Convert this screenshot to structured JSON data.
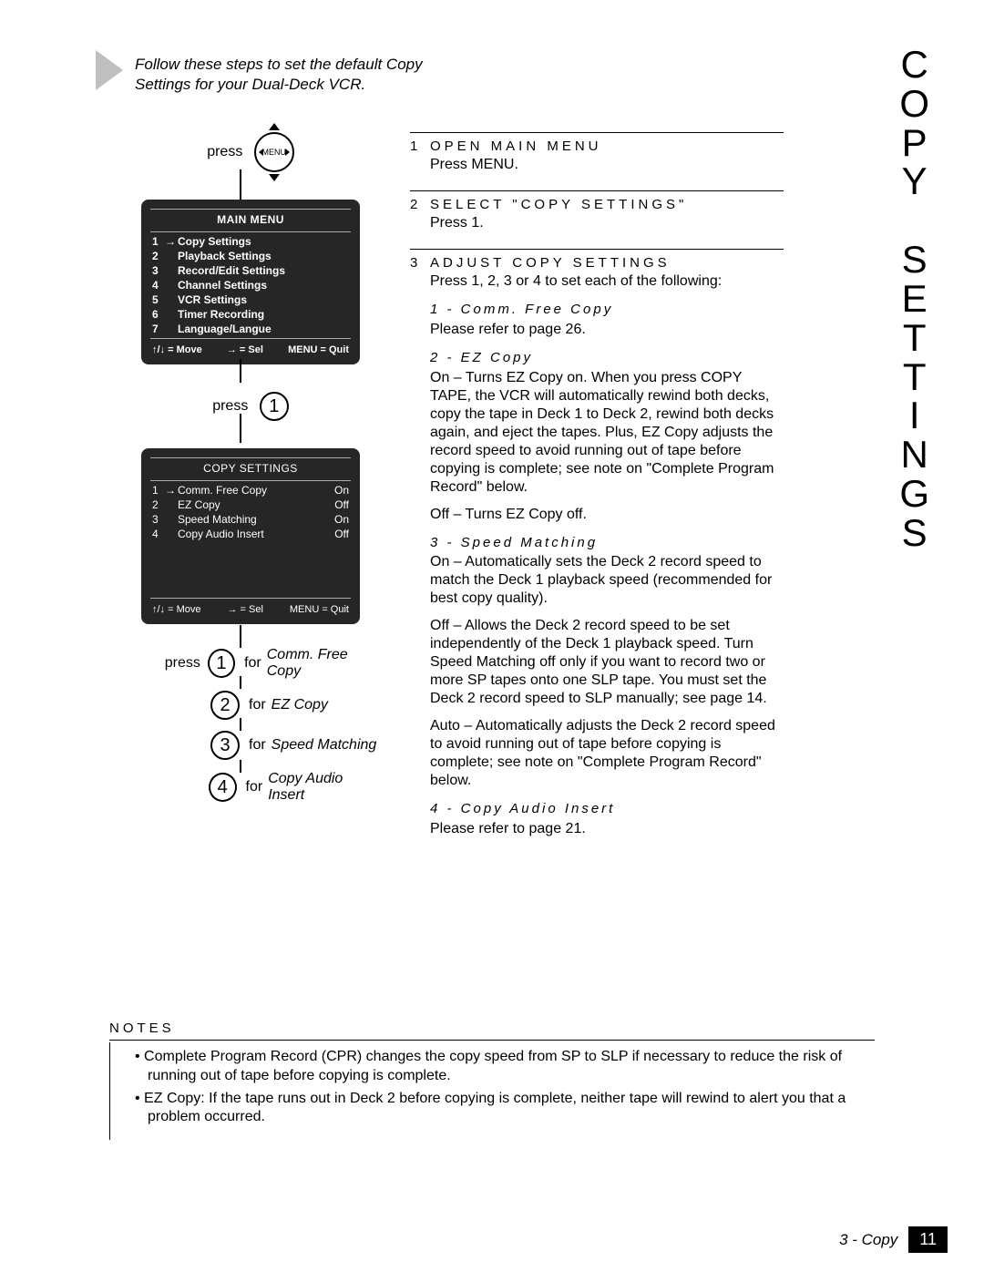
{
  "side_title": "COPY SETTINGS",
  "intro": "Follow these steps to set the default Copy Settings for your Dual-Deck VCR.",
  "press": "press",
  "for": "for",
  "menu_button": "MENU",
  "main_menu": {
    "title": "MAIN MENU",
    "items": [
      {
        "n": "1",
        "arrow": "→",
        "label": "Copy Settings"
      },
      {
        "n": "2",
        "arrow": "",
        "label": "Playback Settings"
      },
      {
        "n": "3",
        "arrow": "",
        "label": "Record/Edit Settings"
      },
      {
        "n": "4",
        "arrow": "",
        "label": "Channel Settings"
      },
      {
        "n": "5",
        "arrow": "",
        "label": "VCR Settings"
      },
      {
        "n": "6",
        "arrow": "",
        "label": "Timer Recording"
      },
      {
        "n": "7",
        "arrow": "",
        "label": "Language/Langue"
      }
    ],
    "footer": {
      "move": "↑/↓ = Move",
      "sel": "→ = Sel",
      "quit": "MENU = Quit"
    }
  },
  "press_1": "1",
  "copy_menu": {
    "title": "COPY SETTINGS",
    "items": [
      {
        "n": "1",
        "arrow": "→",
        "label": "Comm. Free Copy",
        "val": "On"
      },
      {
        "n": "2",
        "arrow": "",
        "label": "EZ Copy",
        "val": "Off"
      },
      {
        "n": "3",
        "arrow": "",
        "label": "Speed Matching",
        "val": "On"
      },
      {
        "n": "4",
        "arrow": "",
        "label": "Copy Audio Insert",
        "val": "Off"
      }
    ],
    "footer": {
      "move": "↑/↓ = Move",
      "sel": "→ = Sel",
      "quit": "MENU = Quit"
    }
  },
  "options": [
    {
      "n": "1",
      "name": "Comm. Free Copy"
    },
    {
      "n": "2",
      "name": "EZ Copy"
    },
    {
      "n": "3",
      "name": "Speed Matching"
    },
    {
      "n": "4",
      "name": "Copy Audio Insert"
    }
  ],
  "steps": {
    "s1": {
      "n": "1",
      "title": "OPEN MAIN MENU",
      "body": "Press MENU."
    },
    "s2": {
      "n": "2",
      "title": "SELECT \"COPY SETTINGS\"",
      "body": "Press 1."
    },
    "s3": {
      "n": "3",
      "title": "ADJUST COPY SETTINGS",
      "lead": "Press 1, 2, 3 or 4 to set each of the following:",
      "sub1": {
        "t": "1 - Comm. Free Copy",
        "b": "Please refer to page 26."
      },
      "sub2": {
        "t": "2 - EZ Copy",
        "on": "On – Turns EZ Copy on. When you press COPY TAPE, the VCR will automatically rewind both decks, copy the tape in Deck 1 to Deck 2, rewind both decks again, and eject the tapes. Plus, EZ Copy adjusts the record speed to avoid running out of tape before copying is complete; see note on \"Complete Program Record\" below.",
        "off": "Off – Turns EZ Copy off."
      },
      "sub3": {
        "t": "3 - Speed Matching",
        "on": "On – Automatically sets the Deck 2 record speed to match the Deck 1 playback speed (recommended for best copy quality).",
        "off": "Off – Allows the Deck 2 record speed to be set independently of the Deck 1 playback speed. Turn Speed Matching off only if you want to record two or more SP tapes onto one SLP tape. You must set the Deck 2 record speed to SLP manually; see page 14.",
        "auto": "Auto – Automatically adjusts the Deck 2 record speed to avoid running out of tape before copying is complete; see note on \"Complete Program Record\" below."
      },
      "sub4": {
        "t": "4 - Copy Audio Insert",
        "b": "Please refer to page 21."
      }
    }
  },
  "notes": {
    "title": "NOTES",
    "items": [
      "Complete Program Record (CPR) changes the copy speed from SP to SLP if necessary to reduce the risk of running out of tape before copying is complete.",
      "EZ Copy: If the tape runs out in Deck 2 before copying is complete, neither tape will rewind to alert you that a problem occurred."
    ]
  },
  "footer": {
    "section": "3 - Copy",
    "page": "11"
  }
}
